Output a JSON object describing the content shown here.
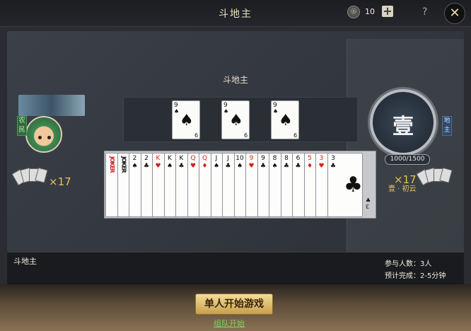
{
  "header": {
    "title": "斗地主",
    "coins": "10",
    "coin_icon": "☉",
    "plus_icon": "+",
    "help_icon": "?",
    "close_icon": "✕"
  },
  "table": {
    "game_label": "斗地主"
  },
  "played_cards": [
    {
      "rank": "9",
      "suit": "♠"
    },
    {
      "rank": "9",
      "suit": "♠"
    },
    {
      "rank": "9",
      "suit": "♠"
    }
  ],
  "hand": [
    {
      "rank": "JOKER",
      "color": "red",
      "joker": true
    },
    {
      "rank": "JOKER",
      "color": "black",
      "joker": true
    },
    {
      "rank": "2",
      "suit": "♠",
      "color": "black"
    },
    {
      "rank": "2",
      "suit": "♣",
      "color": "black"
    },
    {
      "rank": "K",
      "suit": "♥",
      "color": "red"
    },
    {
      "rank": "K",
      "suit": "♠",
      "color": "black"
    },
    {
      "rank": "K",
      "suit": "♣",
      "color": "black"
    },
    {
      "rank": "Q",
      "suit": "♥",
      "color": "red"
    },
    {
      "rank": "Q",
      "suit": "♦",
      "color": "red"
    },
    {
      "rank": "J",
      "suit": "♠",
      "color": "black"
    },
    {
      "rank": "J",
      "suit": "♣",
      "color": "black"
    },
    {
      "rank": "10",
      "suit": "♠",
      "color": "black"
    },
    {
      "rank": "9",
      "suit": "♥",
      "color": "red"
    },
    {
      "rank": "9",
      "suit": "♣",
      "color": "black"
    },
    {
      "rank": "8",
      "suit": "♠",
      "color": "black"
    },
    {
      "rank": "8",
      "suit": "♣",
      "color": "black"
    },
    {
      "rank": "6",
      "suit": "♣",
      "color": "black"
    },
    {
      "rank": "5",
      "suit": "♦",
      "color": "red"
    },
    {
      "rank": "3",
      "suit": "♥",
      "color": "red"
    },
    {
      "rank": "3",
      "suit": "♣",
      "color": "black"
    }
  ],
  "left_player": {
    "role": "农民",
    "card_count": "×17"
  },
  "right_player": {
    "role": "地主",
    "card_count": "×17",
    "badge_glyph": "壹",
    "score": "1000/1500",
    "rank_name": "壹 · 初云"
  },
  "info": {
    "title": "斗地主",
    "players_label": "参与人数：3人",
    "duration_label": "预计完成：2-5分钟"
  },
  "actions": {
    "start_solo": "单人开始游戏",
    "start_team": "组队开始"
  }
}
